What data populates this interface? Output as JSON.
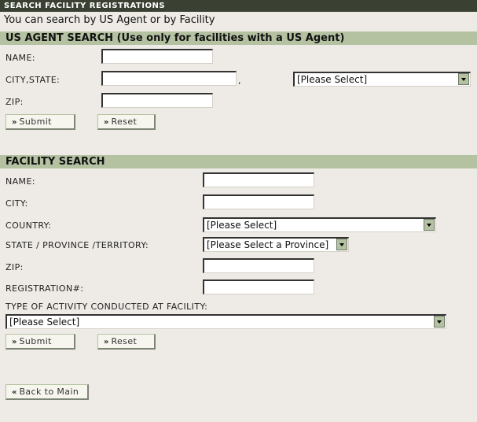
{
  "page": {
    "title": "SEARCH FACILITY REGISTRATIONS",
    "intro": "You can search by US Agent or by Facility"
  },
  "agent_search": {
    "header": "US AGENT SEARCH (Use only for facilities with a US Agent)",
    "name_label": "NAME:",
    "name_value": "",
    "city_state_label": "CITY,STATE:",
    "city_value": "",
    "comma": ",",
    "state_select": "[Please Select]",
    "zip_label": "ZIP:",
    "zip_value": "",
    "submit_label": "Submit",
    "reset_label": "Reset"
  },
  "facility_search": {
    "header": "FACILITY SEARCH",
    "name_label": "NAME:",
    "city_label": "CITY:",
    "country_label": "COUNTRY:",
    "country_select": "[Please Select]",
    "province_label": "STATE / PROVINCE /TERRITORY:",
    "province_select": "[Please Select a Province]",
    "zip_label": "ZIP:",
    "registration_label": "REGISTRATION#:",
    "activity_label": "TYPE OF ACTIVITY CONDUCTED AT FACILITY:",
    "activity_select": "[Please Select]",
    "submit_label": "Submit",
    "reset_label": "Reset"
  },
  "footer": {
    "back_label": "Back to Main"
  },
  "icons": {
    "forward": "»",
    "back": "«"
  }
}
